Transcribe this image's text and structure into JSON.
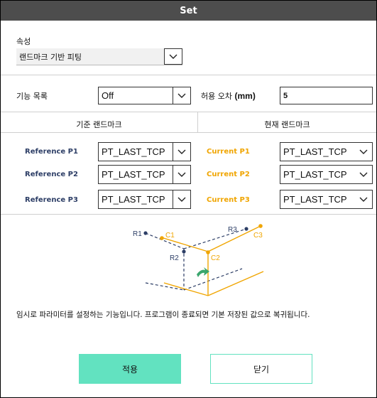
{
  "dialog": {
    "title": "Set"
  },
  "property": {
    "label": "속성",
    "value": "랜드마크 기반 피팅"
  },
  "feature_list": {
    "label": "기능 목록",
    "value": "Off"
  },
  "tolerance": {
    "label_prefix": "허용 오차 ",
    "label_unit": "(mm)",
    "value": "5"
  },
  "reference": {
    "header": "기준 랜드마크",
    "rows": [
      {
        "label": "Reference P1",
        "value": "PT_LAST_TCP"
      },
      {
        "label": "Reference P2",
        "value": "PT_LAST_TCP"
      },
      {
        "label": "Reference P3",
        "value": "PT_LAST_TCP"
      }
    ]
  },
  "current": {
    "header": "현재 랜드마크",
    "rows": [
      {
        "label": "Current P1",
        "value": "PT_LAST_TCP"
      },
      {
        "label": "Current P2",
        "value": "PT_LAST_TCP"
      },
      {
        "label": "Current P3",
        "value": "PT_LAST_TCP"
      }
    ]
  },
  "diagram": {
    "labels": {
      "r1": "R1",
      "r2": "R2",
      "r3": "R3",
      "c1": "C1",
      "c2": "C2",
      "c3": "C3"
    }
  },
  "note": "임시로 파라미터를 설정하는 기능입니다. 프로그램이 종료되면 기본 저장된 값으로 복귀됩니다.",
  "buttons": {
    "apply": "적용",
    "close": "닫기"
  },
  "colors": {
    "title_bg": "#4d4d4d",
    "accent_orange": "#f0a500",
    "reference_blue": "#2d3e66",
    "apply_bg": "#62e2c0",
    "close_border": "#62e2c0"
  },
  "icons": {
    "dropdown": "chevron-down-icon"
  }
}
